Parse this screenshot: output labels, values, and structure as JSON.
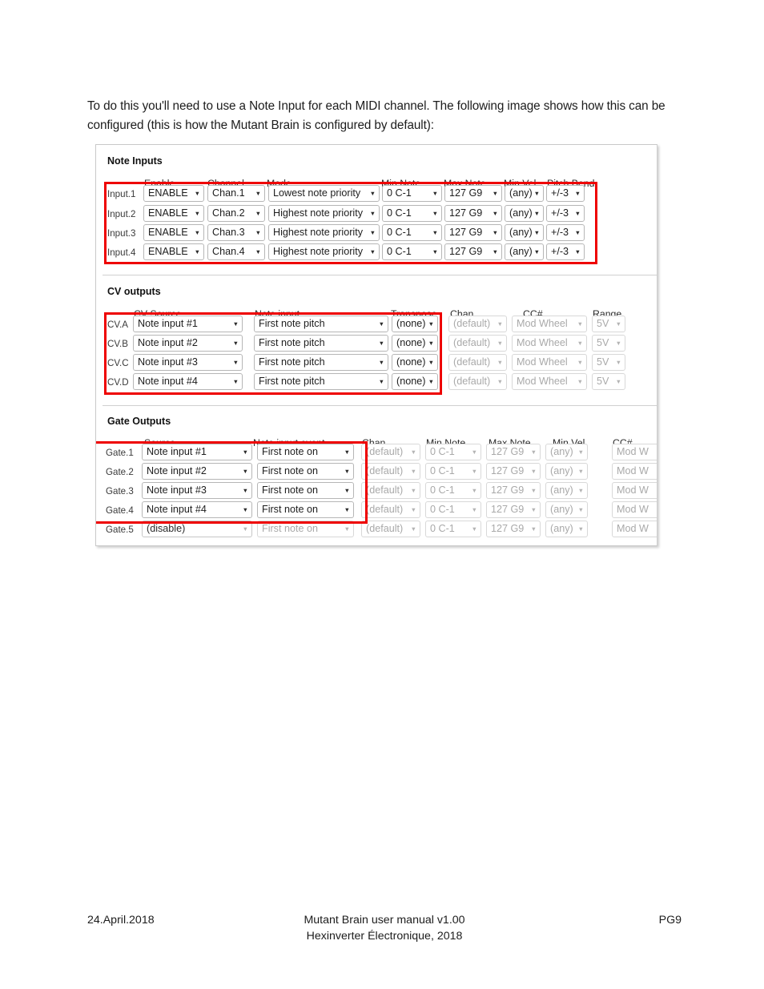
{
  "document": {
    "intro_paragraph": "To do this you'll need to use a Note Input for each MIDI channel. The following image shows how this can be configured (this is how the Mutant Brain is configured by default):",
    "footer": {
      "date": "24.April.2018",
      "title": "Mutant Brain user manual v1.00",
      "publisher": "Hexinverter Électronique, 2018",
      "page": "PG9"
    }
  },
  "app": {
    "accent_red": "#ee0000",
    "note_inputs": {
      "title": "Note Inputs",
      "columns": [
        "Enable",
        "Channel",
        "Mode",
        "Min Note",
        "Max Note",
        "Min Vel",
        "Pitch Bend"
      ],
      "rows": [
        {
          "label": "Input.1",
          "enable": "ENABLE",
          "channel": "Chan.1",
          "mode": "Lowest note priority",
          "min_note": "0 C-1",
          "max_note": "127 G9",
          "min_vel": "(any)",
          "pitch_bend": "+/-3"
        },
        {
          "label": "Input.2",
          "enable": "ENABLE",
          "channel": "Chan.2",
          "mode": "Highest note priority",
          "min_note": "0 C-1",
          "max_note": "127 G9",
          "min_vel": "(any)",
          "pitch_bend": "+/-3"
        },
        {
          "label": "Input.3",
          "enable": "ENABLE",
          "channel": "Chan.3",
          "mode": "Highest note priority",
          "min_note": "0 C-1",
          "max_note": "127 G9",
          "min_vel": "(any)",
          "pitch_bend": "+/-3"
        },
        {
          "label": "Input.4",
          "enable": "ENABLE",
          "channel": "Chan.4",
          "mode": "Highest note priority",
          "min_note": "0 C-1",
          "max_note": "127 G9",
          "min_vel": "(any)",
          "pitch_bend": "+/-3"
        }
      ]
    },
    "cv_outputs": {
      "title": "CV outputs",
      "columns": [
        "CV Source",
        "Note input",
        "Transpose",
        "Chan",
        "CC#",
        "Range"
      ],
      "rows": [
        {
          "label": "CV.A",
          "source": "Note input #1",
          "note_input": "First note pitch",
          "transpose": "(none)",
          "chan": "(default)",
          "cc": "Mod Wheel",
          "range": "5V"
        },
        {
          "label": "CV.B",
          "source": "Note input #2",
          "note_input": "First note pitch",
          "transpose": "(none)",
          "chan": "(default)",
          "cc": "Mod Wheel",
          "range": "5V"
        },
        {
          "label": "CV.C",
          "source": "Note input #3",
          "note_input": "First note pitch",
          "transpose": "(none)",
          "chan": "(default)",
          "cc": "Mod Wheel",
          "range": "5V"
        },
        {
          "label": "CV.D",
          "source": "Note input #4",
          "note_input": "First note pitch",
          "transpose": "(none)",
          "chan": "(default)",
          "cc": "Mod Wheel",
          "range": "5V"
        }
      ]
    },
    "gate_outputs": {
      "title": "Gate Outputs",
      "columns": [
        "Source",
        "Note input event",
        "Chan",
        "Min.Note",
        "Max.Note",
        "Min Vel.",
        "CC#"
      ],
      "rows": [
        {
          "label": "Gate.1",
          "source": "Note input #1",
          "event": "First note on",
          "chan": "(default)",
          "min_note": "0 C-1",
          "max_note": "127 G9",
          "min_vel": "(any)",
          "cc": "Mod W"
        },
        {
          "label": "Gate.2",
          "source": "Note input #2",
          "event": "First note on",
          "chan": "(default)",
          "min_note": "0 C-1",
          "max_note": "127 G9",
          "min_vel": "(any)",
          "cc": "Mod W"
        },
        {
          "label": "Gate.3",
          "source": "Note input #3",
          "event": "First note on",
          "chan": "(default)",
          "min_note": "0 C-1",
          "max_note": "127 G9",
          "min_vel": "(any)",
          "cc": "Mod W"
        },
        {
          "label": "Gate.4",
          "source": "Note input #4",
          "event": "First note on",
          "chan": "(default)",
          "min_note": "0 C-1",
          "max_note": "127 G9",
          "min_vel": "(any)",
          "cc": "Mod W"
        },
        {
          "label": "Gate.5",
          "source": "(disable)",
          "event": "First note on",
          "chan": "(default)",
          "min_note": "0 C-1",
          "max_note": "127 G9",
          "min_vel": "(any)",
          "cc": "Mod W"
        }
      ]
    }
  }
}
